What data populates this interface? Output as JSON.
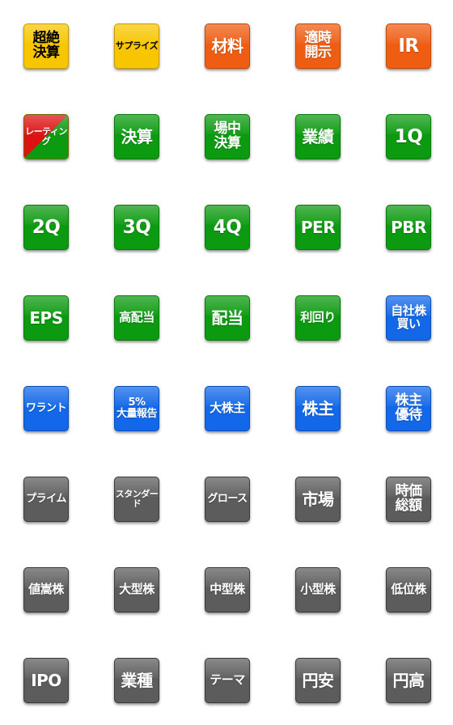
{
  "stickers": [
    {
      "label": "超絶\n決算",
      "color": "yellow"
    },
    {
      "label": "サプライズ",
      "color": "yellow"
    },
    {
      "label": "材料",
      "color": "orange"
    },
    {
      "label": "適時\n開示",
      "color": "orange"
    },
    {
      "label": "IR",
      "color": "orange"
    },
    {
      "label": "レーティング",
      "color": "split"
    },
    {
      "label": "決算",
      "color": "green"
    },
    {
      "label": "場中\n決算",
      "color": "green"
    },
    {
      "label": "業績",
      "color": "green"
    },
    {
      "label": "1Q",
      "color": "green"
    },
    {
      "label": "2Q",
      "color": "green"
    },
    {
      "label": "3Q",
      "color": "green"
    },
    {
      "label": "4Q",
      "color": "green"
    },
    {
      "label": "PER",
      "color": "green"
    },
    {
      "label": "PBR",
      "color": "green"
    },
    {
      "label": "EPS",
      "color": "green"
    },
    {
      "label": "高配当",
      "color": "green"
    },
    {
      "label": "配当",
      "color": "green"
    },
    {
      "label": "利回り",
      "color": "green"
    },
    {
      "label": "自社株\n買い",
      "color": "blue"
    },
    {
      "label": "ワラント",
      "color": "blue"
    },
    {
      "label": "5%\n大量報告",
      "color": "blue"
    },
    {
      "label": "大株主",
      "color": "blue"
    },
    {
      "label": "株主",
      "color": "blue"
    },
    {
      "label": "株主\n優待",
      "color": "blue"
    },
    {
      "label": "プライム",
      "color": "gray"
    },
    {
      "label": "スタンダード",
      "color": "gray"
    },
    {
      "label": "グロース",
      "color": "gray"
    },
    {
      "label": "市場",
      "color": "gray"
    },
    {
      "label": "時価\n総額",
      "color": "gray"
    },
    {
      "label": "値嵩株",
      "color": "gray"
    },
    {
      "label": "大型株",
      "color": "gray"
    },
    {
      "label": "中型株",
      "color": "gray"
    },
    {
      "label": "小型株",
      "color": "gray"
    },
    {
      "label": "低位株",
      "color": "gray"
    },
    {
      "label": "IPO",
      "color": "gray"
    },
    {
      "label": "業種",
      "color": "gray"
    },
    {
      "label": "テーマ",
      "color": "gray"
    },
    {
      "label": "円安",
      "color": "gray"
    },
    {
      "label": "円高",
      "color": "gray"
    }
  ],
  "colors": {
    "yellow": "#f7c600",
    "orange": "#ee5d12",
    "green": "#0c9a10",
    "blue": "#1268e8",
    "gray": "#5c5c5c",
    "red": "#dd1212"
  }
}
